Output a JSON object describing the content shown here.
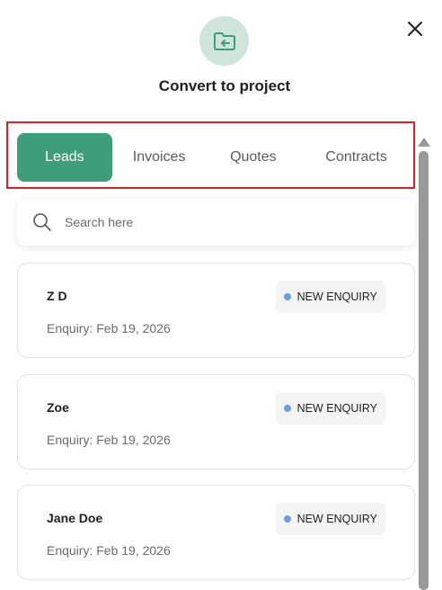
{
  "header": {
    "title": "Convert to project",
    "icon": "folder-return-icon",
    "close_icon": "close-icon"
  },
  "tabs": [
    {
      "label": "Leads",
      "active": true
    },
    {
      "label": "Invoices",
      "active": false
    },
    {
      "label": "Quotes",
      "active": false
    },
    {
      "label": "Contracts",
      "active": false
    }
  ],
  "search": {
    "placeholder": "Search here",
    "value": ""
  },
  "leads": [
    {
      "name": "Z D",
      "date": "Enquiry: Feb 19, 2026",
      "status": "NEW ENQUIRY"
    },
    {
      "name": "Zoe",
      "date": "Enquiry: Feb 19, 2026",
      "status": "NEW ENQUIRY"
    },
    {
      "name": "Jane Doe",
      "date": "Enquiry: Feb 19, 2026",
      "status": "NEW ENQUIRY"
    }
  ],
  "colors": {
    "accent": "#3f9e7a",
    "icon_circle": "#cfe5da",
    "highlight_border": "#d92027",
    "status_dot": "#6f9be6"
  }
}
